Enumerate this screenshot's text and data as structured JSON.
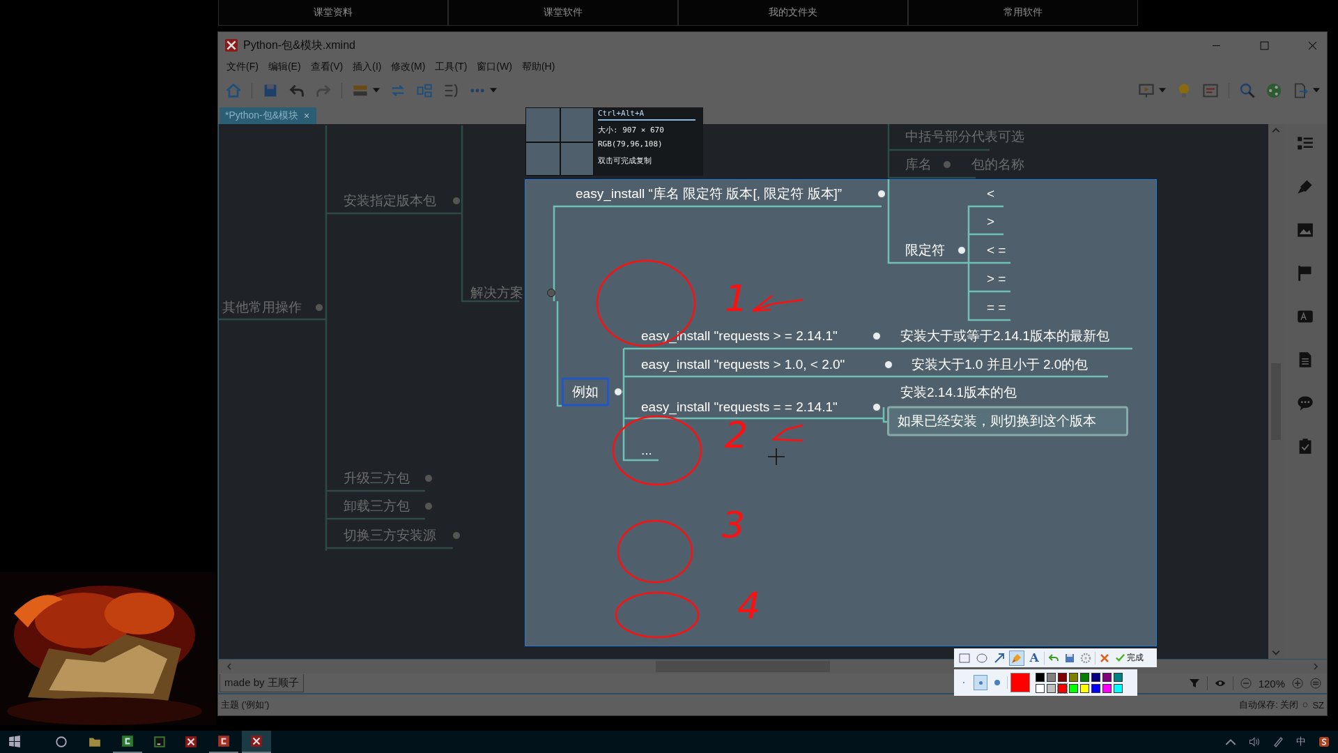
{
  "top_tabs": [
    "课堂资料",
    "课堂软件",
    "我的文件夹",
    "常用软件"
  ],
  "window": {
    "title": "Python-包&模块.xmind",
    "menu": [
      "文件(F)",
      "编辑(E)",
      "查看(V)",
      "插入(I)",
      "修改(M)",
      "工具(T)",
      "窗口(W)",
      "帮助(H)"
    ],
    "document_tab": {
      "label": "*Python-包&模块",
      "close": "×"
    }
  },
  "mindmap": {
    "nodes": [
      {
        "text": "其他常用操作",
        "kind": "plain",
        "highlighted": false,
        "selected": false
      },
      {
        "text": "安装指定版本包",
        "kind": "plain",
        "highlighted": false,
        "selected": false
      },
      {
        "text": "解决方案",
        "kind": "plain",
        "highlighted": false,
        "selected": false
      },
      {
        "text": "升级三方包",
        "kind": "plain",
        "highlighted": false,
        "selected": false
      },
      {
        "text": "卸载三方包",
        "kind": "plain",
        "highlighted": false,
        "selected": false
      },
      {
        "text": "切换三方安装源",
        "kind": "plain",
        "highlighted": false,
        "selected": false
      },
      {
        "text": "中括号部分代表可选",
        "kind": "plain",
        "highlighted": false,
        "selected": false
      },
      {
        "text": "库名",
        "kind": "plain",
        "highlighted": false,
        "selected": false
      },
      {
        "text": "包的名称",
        "kind": "plain",
        "highlighted": false,
        "selected": false
      },
      {
        "text": "easy_install “库名 限定符 版本[, 限定符 版本]”",
        "kind": "plain",
        "highlighted": true,
        "selected": false
      },
      {
        "text": "限定符",
        "kind": "plain",
        "highlighted": true,
        "selected": false
      },
      {
        "text": "<",
        "kind": "plain",
        "highlighted": true,
        "selected": false
      },
      {
        "text": ">",
        "kind": "plain",
        "highlighted": true,
        "selected": false
      },
      {
        "text": "< =",
        "kind": "plain",
        "highlighted": true,
        "selected": false
      },
      {
        "text": "> =",
        "kind": "plain",
        "highlighted": true,
        "selected": false
      },
      {
        "text": "= =",
        "kind": "plain",
        "highlighted": true,
        "selected": false
      },
      {
        "text": "例如",
        "kind": "boxed",
        "highlighted": true,
        "selected": true
      },
      {
        "text": "easy_install \"requests > = 2.14.1\"",
        "kind": "plain",
        "highlighted": true,
        "selected": false
      },
      {
        "text": "安装大于或等于2.14.1版本的最新包",
        "kind": "plain",
        "highlighted": true,
        "selected": false
      },
      {
        "text": "easy_install \"requests > 1.0, < 2.0\"",
        "kind": "plain",
        "highlighted": true,
        "selected": false
      },
      {
        "text": "安装大于1.0 并且小于 2.0的包",
        "kind": "plain",
        "highlighted": true,
        "selected": false
      },
      {
        "text": "easy_install \"requests = = 2.14.1\"",
        "kind": "plain",
        "highlighted": true,
        "selected": false
      },
      {
        "text": "安装2.14.1版本的包",
        "kind": "plain",
        "highlighted": true,
        "selected": false
      },
      {
        "text": "如果已经安装，则切换到这个版本",
        "kind": "callout",
        "highlighted": true,
        "selected": false
      },
      {
        "text": "...",
        "kind": "plain",
        "highlighted": true,
        "selected": false
      }
    ]
  },
  "annotations": {
    "numbers": [
      "1",
      "2",
      "3",
      "4"
    ]
  },
  "capture_info": {
    "shortcut": "Ctrl+Alt+A",
    "size": "大小: 907 × 670",
    "rgb": "RGB(79,96,108)",
    "hint": "双击可完成复制"
  },
  "capture_toolbar": {
    "tools": [
      {
        "kind": "rectangle",
        "selected": false
      },
      {
        "kind": "ellipse",
        "selected": false
      },
      {
        "kind": "arrow",
        "selected": false
      },
      {
        "kind": "brush",
        "selected": true
      },
      {
        "kind": "text",
        "glyph": "A",
        "selected": false
      }
    ],
    "done": "完成",
    "pen_sizes": [
      {
        "selected": false
      },
      {
        "selected": true
      },
      {
        "selected": false
      }
    ],
    "palette": [
      {
        "color": "#000000",
        "selected": false
      },
      {
        "color": "#808080",
        "selected": false
      },
      {
        "color": "#800000",
        "selected": false
      },
      {
        "color": "#808000",
        "selected": false
      },
      {
        "color": "#008000",
        "selected": false
      },
      {
        "color": "#000080",
        "selected": false
      },
      {
        "color": "#800080",
        "selected": false
      },
      {
        "color": "#008080",
        "selected": false
      },
      {
        "color": "#ffffff",
        "selected": false
      },
      {
        "color": "#c0c0c0",
        "selected": false
      },
      {
        "color": "#ff0000",
        "selected": true
      },
      {
        "color": "#00ff00",
        "selected": false
      },
      {
        "color": "#ffff00",
        "selected": false
      },
      {
        "color": "#0000ff",
        "selected": false
      },
      {
        "color": "#ff00ff",
        "selected": false
      },
      {
        "color": "#00ffff",
        "selected": false
      }
    ]
  },
  "bottom_bar": {
    "credit": "made by 王顺子",
    "zoom": "120%"
  },
  "status_bar": {
    "topic": "主题 ('例如')",
    "autosave": "自动保存: 关闭",
    "user": "SZ"
  },
  "taskbar": {
    "apps": [
      {
        "kind": "start"
      },
      {
        "kind": "search"
      },
      {
        "kind": "folder",
        "running": false,
        "selected": false
      },
      {
        "kind": "green",
        "running": true,
        "selected": false
      },
      {
        "kind": "pycharm",
        "running": false,
        "selected": false
      },
      {
        "kind": "xmind",
        "running": false,
        "selected": false
      },
      {
        "kind": "red",
        "running": true,
        "selected": false
      },
      {
        "kind": "xmind",
        "running": true,
        "selected": true
      }
    ],
    "ime": "中"
  }
}
